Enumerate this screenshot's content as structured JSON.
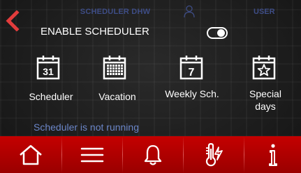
{
  "header": {
    "title": "SCHEDULER DHW",
    "user_label": "USER"
  },
  "enable": {
    "label": "ENABLE SCHEDULER",
    "state": "on"
  },
  "menu": {
    "scheduler": {
      "label": "Scheduler",
      "icon_text": "31"
    },
    "vacation": {
      "label": "Vacation"
    },
    "weekly": {
      "label": "Weekly Sch.",
      "icon_text": "7"
    },
    "special": {
      "label_line1": "Special",
      "label_line2": "days"
    }
  },
  "status_text": "Scheduler is not running",
  "colors": {
    "accent_red": "#c40000",
    "header_text": "#3e4d86",
    "status_text": "#6b86c8"
  },
  "nav": [
    "home-icon",
    "menu-icon",
    "bell-icon",
    "thermometer-icon",
    "info-icon"
  ]
}
